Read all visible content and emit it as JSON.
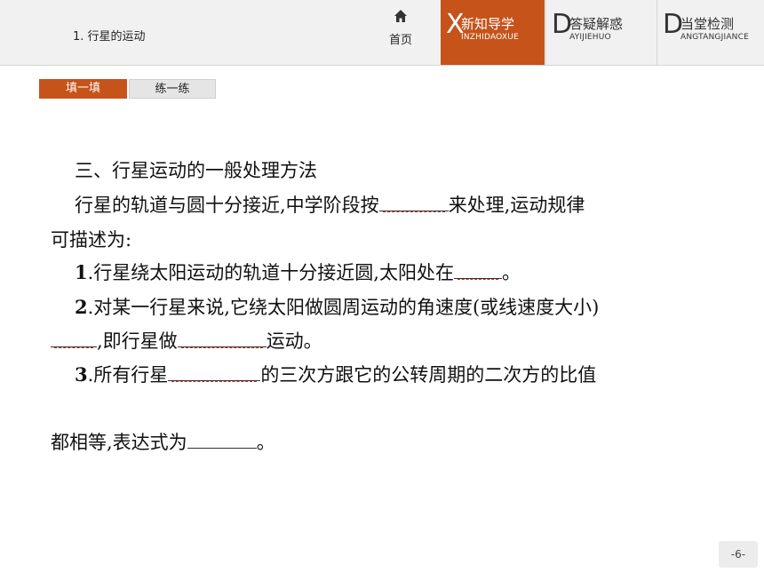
{
  "header": {
    "lesson_title": "1. 行星的运动",
    "home_label": "首页",
    "tabs": [
      {
        "letter": "X",
        "title": "新知导学",
        "pinyin": "INZHIDAOXUE"
      },
      {
        "letter": "D",
        "title": "答疑解惑",
        "pinyin": "AYIJIEHUO"
      },
      {
        "letter": "D",
        "title": "当堂检测",
        "pinyin": "ANGTANGJIANCE"
      }
    ],
    "accent_color": "#c5531a"
  },
  "subtabs": [
    "填一填",
    "练一练"
  ],
  "content": {
    "heading": "三、行星运动的一般处理方法",
    "intro_a": "行星的轨道与圆十分接近,中学阶段按",
    "intro_b": "来处理,运动规律",
    "intro_c": "可描述为:",
    "item1_num": "1",
    "item1_a": ".行星绕太阳运动的轨道十分接近圆,太阳处在",
    "item1_b": "。",
    "item2_num": "2",
    "item2_a": ".对某一行星来说,它绕太阳做圆周运动的角速度(或线速度大小)",
    "item2_b": ",即行星做",
    "item2_c": "运动。",
    "item3_num": "3",
    "item3_a": ".所有行星",
    "item3_b": "的三次方跟它的公转周期的二次方的比值",
    "item3_c": "都相等,表达式为",
    "item3_d": "。"
  },
  "page_number": "-6-"
}
